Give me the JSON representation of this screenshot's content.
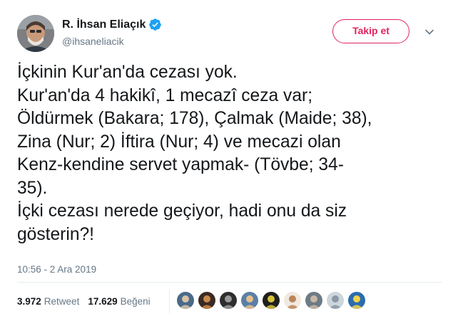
{
  "user": {
    "display_name": "R. İhsan Eliaçık",
    "handle": "@ihsaneliacik",
    "verified_icon": "verified-badge-icon"
  },
  "follow_button": {
    "label": "Takip et",
    "color": "#e0245e"
  },
  "menu_icon": "chevron-down-icon",
  "tweet": {
    "lines": [
      "İçkinin Kur'an'da cezası yok.",
      "Kur'an'da 4 hakikî, 1 mecazî ceza var;",
      "Öldürmek (Bakara; 178), Çalmak (Maide; 38),",
      "Zina (Nur; 2) İftira (Nur; 4) ve mecazi olan",
      "Kenz-kendine servet yapmak- (Tövbe; 34-",
      "35).",
      "İçki cezası nerede geçiyor, hadi onu da siz",
      "gösterin?!"
    ],
    "timestamp": "10:56 - 2 Ara 2019"
  },
  "stats": {
    "retweets_count": "3.972",
    "retweets_label": "Retweet",
    "likes_count": "17.629",
    "likes_label": "Beğeni"
  },
  "likers": [
    {
      "icon": "liker-avatar-1",
      "bg": "#4a6a8a",
      "fg": "#d8c3a5"
    },
    {
      "icon": "liker-avatar-2",
      "bg": "#3b2a22",
      "fg": "#c98a4b"
    },
    {
      "icon": "liker-avatar-3",
      "bg": "#2e2e2e",
      "fg": "#9a9a9a"
    },
    {
      "icon": "liker-avatar-4",
      "bg": "#5b7fa8",
      "fg": "#e6c089"
    },
    {
      "icon": "liker-avatar-5",
      "bg": "#1f1f1f",
      "fg": "#d4c23a"
    },
    {
      "icon": "liker-avatar-6",
      "bg": "#f1e8df",
      "fg": "#b8865a"
    },
    {
      "icon": "liker-avatar-7",
      "bg": "#6d7b86",
      "fg": "#c9b8a6"
    },
    {
      "icon": "liker-avatar-8",
      "bg": "#cdd6dd",
      "fg": "#8a99a6"
    },
    {
      "icon": "liker-avatar-9",
      "bg": "#2b6cb0",
      "fg": "#f2d24b"
    }
  ]
}
